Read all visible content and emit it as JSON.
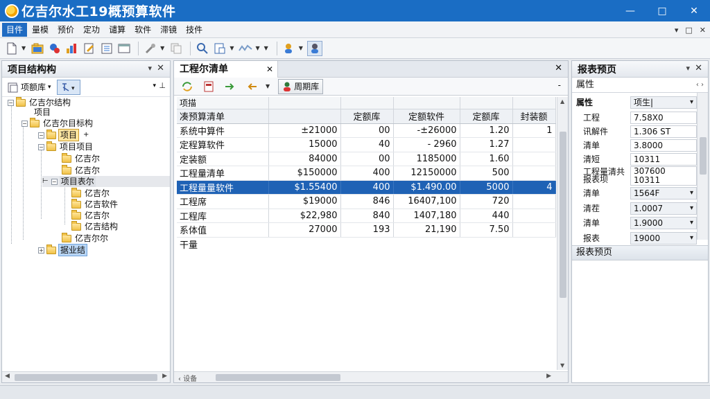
{
  "app": {
    "title": "亿吉尔水工19概预算软件"
  },
  "window": {
    "minimize": "—",
    "maximize": "□",
    "close": "✕"
  },
  "menu": {
    "items": [
      "目件",
      "量模",
      "预价",
      "定功",
      "谴算",
      "软件",
      "滞镜",
      "技件"
    ],
    "right": [
      "▾",
      "□",
      "✕"
    ]
  },
  "left_panel": {
    "title": "项目结构构",
    "select_label": "项额库",
    "select_arrow": "▾",
    "pin": "▾ ⊥",
    "tree": [
      "亿吉尔结构",
      "项目",
      "亿吉尔目标构",
      "项目",
      "项目项目",
      "亿吉尔",
      "亿吉尔",
      "项目表尔",
      "亿吉尔",
      "亿吉软件",
      "亿吉尔",
      "亿吉结构",
      "亿吉尔尔",
      "据业结"
    ]
  },
  "center_panel": {
    "tab": "工程尔清单",
    "tools": {
      "action_label": "周期库"
    },
    "table": {
      "top_header": "项描",
      "headers": [
        "凑预算清单",
        "",
        "定额库",
        "定额软件",
        "定额库",
        "封装额"
      ],
      "rows": [
        [
          "系统中算件",
          "±21000",
          "00",
          "-±26000",
          "1.20",
          "1"
        ],
        [
          "定程算软件",
          "15000",
          "40",
          "- 2960",
          "1.27",
          ""
        ],
        [
          "定装额",
          "84000",
          "00",
          "1185000",
          "1.60",
          ""
        ],
        [
          "工程量清单",
          "$150000",
          "400",
          "12150000",
          "500",
          ""
        ],
        [
          "工程量量软件",
          "$1.55400",
          "400",
          "$1.490.00",
          "5000",
          "4"
        ],
        [
          "工程席",
          "$19000",
          "846",
          "16407,100",
          "720",
          ""
        ],
        [
          "工程库",
          "$22,980",
          "840",
          "1407,180",
          "440",
          ""
        ],
        [
          "系体值",
          "27000",
          "193",
          "21,190",
          "7.50",
          ""
        ],
        [
          "干量",
          "",
          "",
          "",
          "",
          ""
        ]
      ],
      "selected_row": 4
    },
    "hscroll_label": "‹ 设备"
  },
  "right_panel": {
    "title": "报表预页",
    "prop_title": "属性",
    "props": [
      {
        "key": "属性",
        "value": "项生|",
        "dropdown": true
      },
      {
        "key": "工程",
        "value": "7.58X0",
        "dropdown": false
      },
      {
        "key": "讯解件",
        "value": "1.306 ST",
        "dropdown": false
      },
      {
        "key": "清单",
        "value": "3.8000",
        "dropdown": false
      },
      {
        "key": "清短",
        "value": "10311",
        "dropdown": false
      },
      {
        "key": "工程量清共\n报表坝",
        "value": "307600\n10311",
        "dropdown": false
      },
      {
        "key": "清单",
        "value": "1564F",
        "dropdown": true
      },
      {
        "key": "清茬",
        "value": "1.0007",
        "dropdown": true
      },
      {
        "key": "清单",
        "value": "1.9000",
        "dropdown": true
      },
      {
        "key": "报表",
        "value": "19000",
        "dropdown": true
      }
    ],
    "section": "报表预页"
  }
}
